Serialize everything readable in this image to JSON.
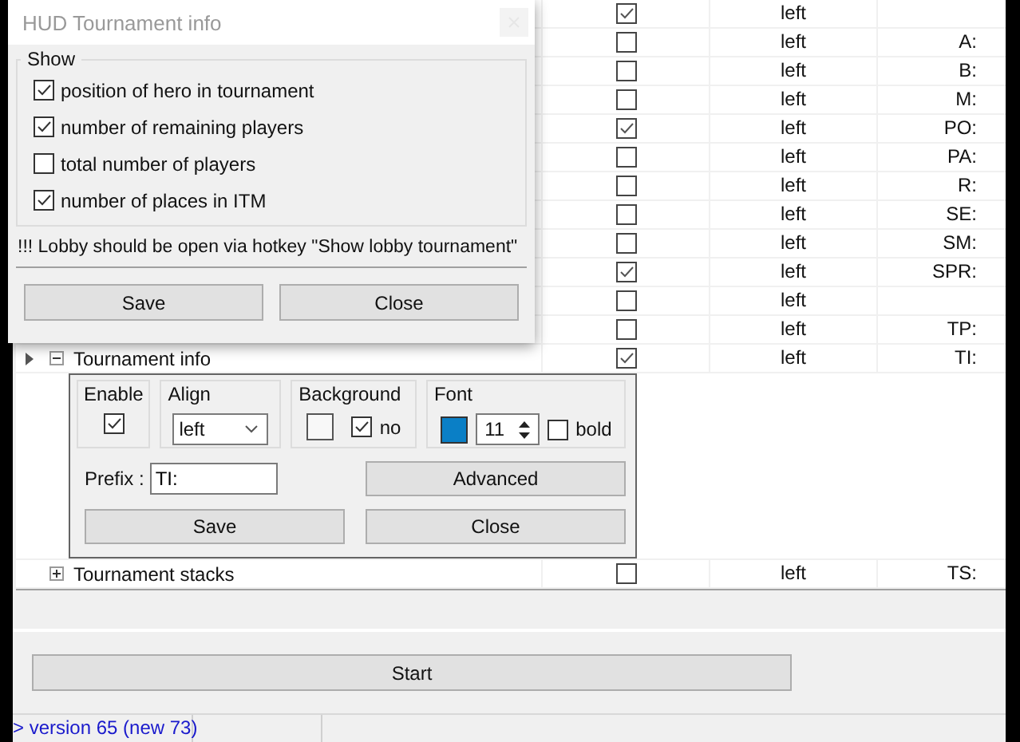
{
  "dialog": {
    "title": "HUD Tournament info",
    "group_label": "Show",
    "options": [
      {
        "label": "position of hero in tournament",
        "checked": true
      },
      {
        "label": "number of remaining players",
        "checked": true
      },
      {
        "label": "total number of players",
        "checked": false
      },
      {
        "label": "number of places in ITM",
        "checked": true
      }
    ],
    "note": "!!! Lobby should be open via hotkey \"Show lobby tournament\"",
    "buttons": [
      "Save",
      "Close"
    ]
  },
  "grid": {
    "rows": [
      {
        "enabled": true,
        "align": "left",
        "prefix": ""
      },
      {
        "enabled": false,
        "align": "left",
        "prefix": "A:"
      },
      {
        "enabled": false,
        "align": "left",
        "prefix": "B:"
      },
      {
        "enabled": false,
        "align": "left",
        "prefix": "M:"
      },
      {
        "enabled": true,
        "align": "left",
        "prefix": "PO:"
      },
      {
        "enabled": false,
        "align": "left",
        "prefix": "PA:"
      },
      {
        "enabled": false,
        "align": "left",
        "prefix": "R:"
      },
      {
        "enabled": false,
        "align": "left",
        "prefix": "SE:"
      },
      {
        "enabled": false,
        "align": "left",
        "prefix": "SM:"
      },
      {
        "enabled": true,
        "align": "left",
        "prefix": "SPR:"
      },
      {
        "enabled": false,
        "align": "left",
        "prefix": ""
      },
      {
        "enabled": false,
        "align": "left",
        "prefix": "TP:"
      },
      {
        "name": "Tournament info",
        "current": true,
        "expanded": true,
        "enabled": true,
        "align": "left",
        "prefix": "TI:"
      },
      {
        "name": "Tournament stacks",
        "current": false,
        "expanded": false,
        "enabled": false,
        "align": "left",
        "prefix": "TS:"
      }
    ]
  },
  "editor": {
    "enable_label": "Enable",
    "enable_checked": true,
    "align_label": "Align",
    "align_value": "left",
    "background_label": "Background",
    "background_no_label": "no",
    "background_no_checked": true,
    "font_label": "Font",
    "font_size": "11",
    "bold_label": "bold",
    "bold_checked": false,
    "prefix_label": "Prefix :",
    "prefix_value": "TI:",
    "advanced_button": "Advanced",
    "buttons": [
      "Save",
      "Close"
    ]
  },
  "start_button": "Start",
  "status_bar": {
    "version": "> version 65 (new 73)"
  }
}
